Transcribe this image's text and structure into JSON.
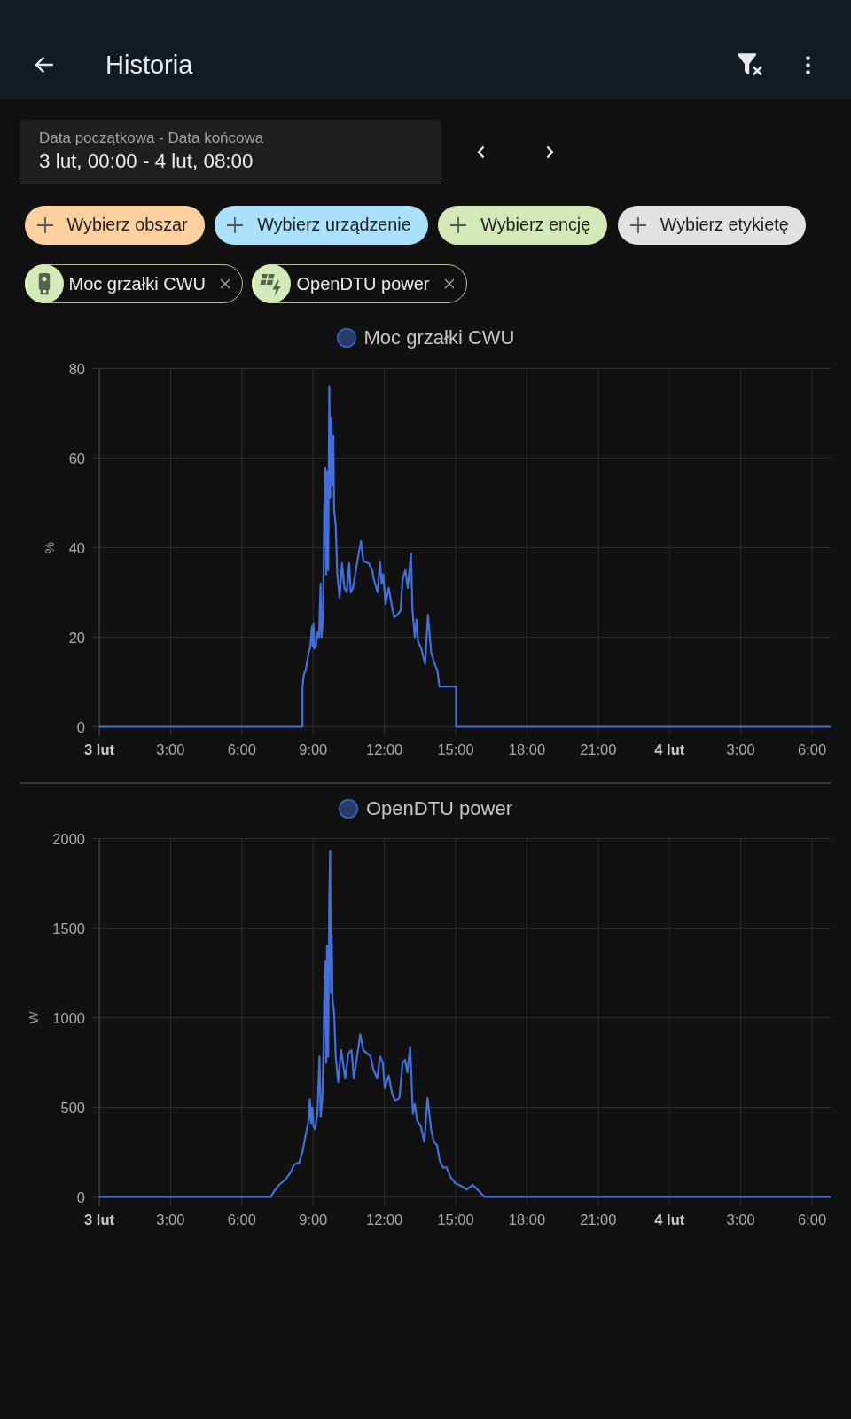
{
  "app_bar": {
    "title": "Historia"
  },
  "date_range": {
    "label": "Data początkowa - Data końcowa",
    "value": "3 lut, 00:00 - 4 lut, 08:00"
  },
  "target_pickers": [
    {
      "label": "Wybierz obszar",
      "color": "#fdd09f"
    },
    {
      "label": "Wybierz urządzenie",
      "color": "#abe1fb"
    },
    {
      "label": "Wybierz encję",
      "color": "#d3e9b7"
    },
    {
      "label": "Wybierz etykietę",
      "color": "#e2e2e2"
    }
  ],
  "entities": [
    {
      "name": "Moc grzałki CWU",
      "kind": "heater"
    },
    {
      "name": "OpenDTU power",
      "kind": "solar"
    }
  ],
  "charts": [
    {
      "chart_data": {
        "type": "line",
        "ylabel": "%",
        "grid": true,
        "x": [
          "--02-03T00:00",
          "--02-03T08:33",
          "--02-03T08:33",
          "--02-03T08:37",
          "--02-03T08:41",
          "--02-03T08:49",
          "--02-03T08:53",
          "--02-03T08:57",
          "--02-03T08:59",
          "--02-03T09:01",
          "--02-03T09:03",
          "--02-03T09:07",
          "--02-03T09:11",
          "--02-03T09:15",
          "--02-03T09:19",
          "--02-03T09:21",
          "--02-03T09:25",
          "--02-03T09:29",
          "--02-03T09:31",
          "--02-03T09:33",
          "--02-03T09:35",
          "--02-03T09:38",
          "--02-03T09:41",
          "--02-03T09:43",
          "--02-03T09:46",
          "--02-03T09:49",
          "--02-03T09:51",
          "--02-03T09:53",
          "--02-03T09:57",
          "--02-03T10:01",
          "--02-03T10:07",
          "--02-03T10:13",
          "--02-03T10:19",
          "--02-03T10:25",
          "--02-03T10:31",
          "--02-03T10:35",
          "--02-03T10:41",
          "--02-03T10:46",
          "--02-03T10:55",
          "--02-03T11:01",
          "--02-03T11:07",
          "--02-03T11:21",
          "--02-03T11:29",
          "--02-03T11:33",
          "--02-03T11:43",
          "--02-03T11:49",
          "--02-03T11:53",
          "--02-03T11:57",
          "--02-03T12:03",
          "--02-03T12:11",
          "--02-03T12:21",
          "--02-03T12:25",
          "--02-03T12:33",
          "--02-03T12:41",
          "--02-03T12:46",
          "--02-03T12:53",
          "--02-03T12:59",
          "--02-03T13:07",
          "--02-03T13:11",
          "--02-03T13:17",
          "--02-03T13:21",
          "--02-03T13:25",
          "--02-03T13:33",
          "--02-03T13:43",
          "--02-03T13:50",
          "--02-03T13:58",
          "--02-03T14:07",
          "--02-03T14:14",
          "--02-03T14:19",
          "--02-03T15:01",
          "--02-03T15:01",
          "--02-04T06:48"
        ],
        "series": [
          {
            "name": "Moc grzałki CWU",
            "color": "#4470dc",
            "values": [
              0,
              0,
              9,
              11.8,
              12.5,
              16.7,
              18,
              22.4,
              18,
              23,
              17.5,
              18,
              21,
              20,
              32,
              20,
              24,
              54,
              57.7,
              34,
              57,
              35,
              76,
              51,
              69,
              54,
              65,
              48.5,
              45,
              34,
              28.8,
              36.5,
              31,
              30,
              36.5,
              30,
              31,
              34,
              38.7,
              41.5,
              37,
              36.5,
              35,
              33,
              30,
              37,
              32,
              34,
              27.4,
              31,
              26,
              24.5,
              25,
              26,
              33,
              35,
              31,
              38.7,
              26,
              20,
              24,
              19,
              17.5,
              14,
              25,
              16.7,
              14,
              12.5,
              9,
              9,
              0,
              0
            ]
          }
        ],
        "xlim": [
          "--02-03T00:00",
          "--02-04T06:48"
        ],
        "ylim": [
          0,
          80
        ],
        "xticks": [
          {
            "value": "--02-03T00:00",
            "label": "3 lut"
          },
          {
            "value": "--02-03T03:00",
            "label": "3:00"
          },
          {
            "value": "--02-03T06:00",
            "label": "6:00"
          },
          {
            "value": "--02-03T09:00",
            "label": "9:00"
          },
          {
            "value": "--02-03T12:00",
            "label": "12:00"
          },
          {
            "value": "--02-03T15:00",
            "label": "15:00"
          },
          {
            "value": "--02-03T18:00",
            "label": "18:00"
          },
          {
            "value": "--02-03T21:00",
            "label": "21:00"
          },
          {
            "value": "--02-04T00:00",
            "label": "4 lut"
          },
          {
            "value": "--02-04T03:00",
            "label": "3:00"
          },
          {
            "value": "--02-04T06:00",
            "label": "6:00"
          }
        ],
        "yticks": [
          0,
          20,
          40,
          60,
          80
        ]
      }
    },
    {
      "chart_data": {
        "type": "line",
        "ylabel": "W",
        "grid": true,
        "x": [
          "--02-03T00:00",
          "--02-03T07:13",
          "--02-03T07:22",
          "--02-03T07:34",
          "--02-03T07:49",
          "--02-03T08:01",
          "--02-03T08:13",
          "--02-03T08:25",
          "--02-03T08:33",
          "--02-03T08:41",
          "--02-03T08:49",
          "--02-03T08:52",
          "--02-03T08:55",
          "--02-03T08:58",
          "--02-03T09:01",
          "--02-03T09:05",
          "--02-03T09:11",
          "--02-03T09:16",
          "--02-03T09:19",
          "--02-03T09:23",
          "--02-03T09:26",
          "--02-03T09:29",
          "--02-03T09:31",
          "--02-03T09:33",
          "--02-03T09:35",
          "--02-03T09:38",
          "--02-03T09:41",
          "--02-03T09:43",
          "--02-03T09:45",
          "--02-03T09:47",
          "--02-03T09:49",
          "--02-03T09:53",
          "--02-03T09:57",
          "--02-03T10:03",
          "--02-03T10:11",
          "--02-03T10:21",
          "--02-03T10:29",
          "--02-03T10:37",
          "--02-03T10:43",
          "--02-03T10:51",
          "--02-03T10:59",
          "--02-03T11:07",
          "--02-03T11:16",
          "--02-03T11:25",
          "--02-03T11:32",
          "--02-03T11:42",
          "--02-03T11:49",
          "--02-03T11:56",
          "--02-03T12:01",
          "--02-03T12:11",
          "--02-03T12:20",
          "--02-03T12:28",
          "--02-03T12:38",
          "--02-03T12:46",
          "--02-03T12:52",
          "--02-03T12:58",
          "--02-03T13:05",
          "--02-03T13:12",
          "--02-03T13:17",
          "--02-03T13:22",
          "--02-03T13:32",
          "--02-03T13:41",
          "--02-03T13:49",
          "--02-03T13:58",
          "--02-03T14:05",
          "--02-03T14:13",
          "--02-03T14:20",
          "--02-03T14:28",
          "--02-03T14:37",
          "--02-03T14:47",
          "--02-03T14:59",
          "--02-03T15:16",
          "--02-03T15:28",
          "--02-03T15:43",
          "--02-03T15:59",
          "--02-03T16:13",
          "--02-04T06:48"
        ],
        "series": [
          {
            "name": "OpenDTU power",
            "color": "#4470dc",
            "values": [
              0,
              0,
              32,
              67,
              94,
              129,
              182,
              191,
              253,
              341,
              430,
              545,
              412,
              500,
              394,
              377,
              465,
              783,
              447,
              536,
              783,
              1225,
              1314,
              748,
              1402,
              783,
              1668,
              1933,
              1137,
              1455,
              1101,
              1031,
              783,
              642,
              819,
              660,
              800,
              819,
              660,
              783,
              907,
              819,
              801,
              783,
              713,
              660,
              783,
              748,
              607,
              677,
              571,
              536,
              553,
              748,
              766,
              695,
              837,
              465,
              518,
              430,
              394,
              306,
              553,
              377,
              306,
              288,
              200,
              164,
              164,
              111,
              76,
              58,
              41,
              67,
              32,
              0,
              0
            ]
          }
        ],
        "xlim": [
          "--02-03T00:00",
          "--02-04T06:48"
        ],
        "ylim": [
          0,
          2000
        ],
        "xticks": [
          {
            "value": "--02-03T00:00",
            "label": "3 lut"
          },
          {
            "value": "--02-03T03:00",
            "label": "3:00"
          },
          {
            "value": "--02-03T06:00",
            "label": "6:00"
          },
          {
            "value": "--02-03T09:00",
            "label": "9:00"
          },
          {
            "value": "--02-03T12:00",
            "label": "12:00"
          },
          {
            "value": "--02-03T15:00",
            "label": "15:00"
          },
          {
            "value": "--02-03T18:00",
            "label": "18:00"
          },
          {
            "value": "--02-03T21:00",
            "label": "21:00"
          },
          {
            "value": "--02-04T00:00",
            "label": "4 lut"
          },
          {
            "value": "--02-04T03:00",
            "label": "3:00"
          },
          {
            "value": "--02-04T06:00",
            "label": "6:00"
          }
        ],
        "yticks": [
          0,
          500,
          1000,
          1500,
          2000
        ]
      }
    }
  ]
}
